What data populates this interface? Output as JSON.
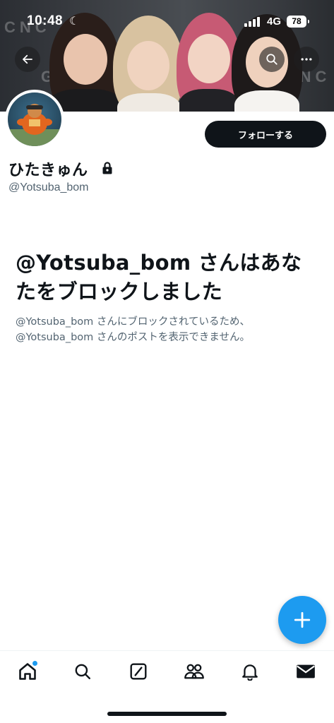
{
  "status_bar": {
    "time": "10:48",
    "network": "4G",
    "battery": "78"
  },
  "banner": {
    "wall_text_left": "CNC",
    "wall_text_mid": "G",
    "wall_text_right": "ENC"
  },
  "header": {
    "back_icon": "arrow-left-icon",
    "search_icon": "search-icon",
    "more_icon": "more-horizontal-icon"
  },
  "profile": {
    "display_name": "ひたきゅん",
    "handle": "@Yotsuba_bom",
    "follow_label": "フォローする",
    "locked": true
  },
  "blocked": {
    "title": "@Yotsuba_bom さんはあなたをブロックしました",
    "body": "@Yotsuba_bom さんにブロックされているため、@Yotsuba_bom さんのポストを表示できません。"
  },
  "fab": {
    "icon": "plus-icon"
  },
  "tabbar": {
    "items": [
      "home-icon",
      "search-icon",
      "grok-icon",
      "communities-icon",
      "notifications-icon",
      "messages-icon"
    ]
  },
  "colors": {
    "accent": "#1d9bf0",
    "text": "#0f1419",
    "secondary": "#536471"
  }
}
